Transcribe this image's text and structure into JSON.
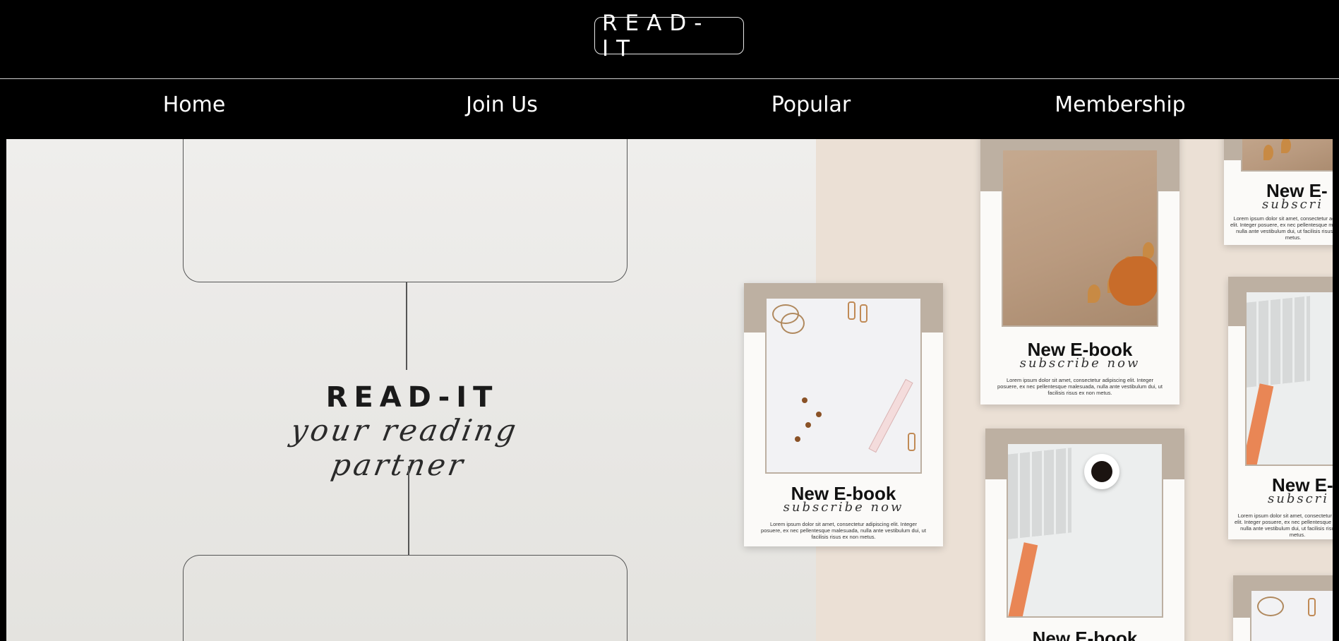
{
  "header": {
    "logo_text": "READ-IT"
  },
  "nav": {
    "items": [
      {
        "label": "Home"
      },
      {
        "label": "Join Us"
      },
      {
        "label": "Popular"
      },
      {
        "label": "Membership"
      }
    ]
  },
  "hero": {
    "title": "READ-IT",
    "tagline": "your reading partner"
  },
  "cards": {
    "title": "New E-book",
    "subtitle": "subscribe now",
    "body": "Lorem ipsum dolor sit amet, consectetur adipiscing elit. Integer posuere, ex nec pellentesque malesuada, nulla ante vestibulum dui, ut facilisis risus ex non metus.",
    "title_partial": "New E-",
    "subtitle_partial": "subscri"
  },
  "colors": {
    "background": "#000000",
    "hero_left": "#efeeec",
    "hero_right": "#ebe0d5",
    "card_band": "#bdb0a2"
  }
}
